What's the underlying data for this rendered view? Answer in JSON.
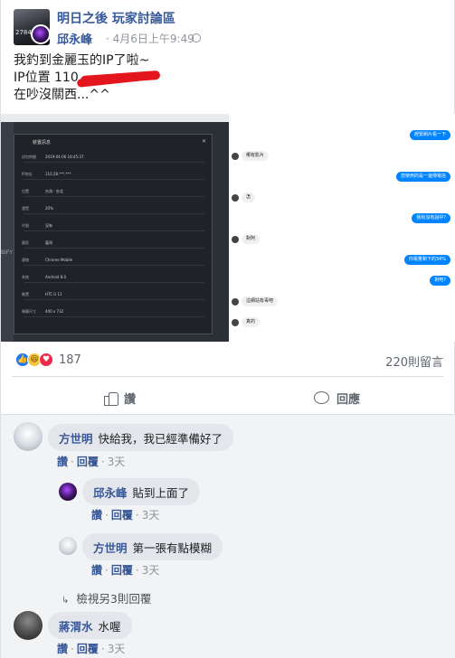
{
  "post": {
    "group_name": "明日之後 玩家討論區",
    "group_avatar_text": "2784",
    "poster_name": "邱永峰",
    "time": "· 4月6日上午9:49",
    "text_line1": "我釣到金麗玉的IP了啦~",
    "text_line2": "IP位置 110.",
    "text_line3": "在吵沒關西...^^",
    "reaction_count": "187",
    "comment_count": "220則留言",
    "like_label": "讚",
    "comment_label": "回應"
  },
  "screenshot_left": {
    "title": "裝置訊息",
    "side_label": "BIFY",
    "rows": [
      {
        "k": "封包時間",
        "v": "2019-04-06 18:45:37"
      },
      {
        "k": "IP地址",
        "v": "110.28.***.***"
      },
      {
        "k": "位置",
        "v": "台灣 · 台北"
      },
      {
        "k": "瀏覽",
        "v": "20%"
      },
      {
        "k": "代號",
        "v": "沒有"
      },
      {
        "k": "國家",
        "v": "臺灣"
      },
      {
        "k": "連線",
        "v": "Chrome Mobile"
      },
      {
        "k": "系統",
        "v": "Android 8.0"
      },
      {
        "k": "裝置",
        "v": "HTC U 11"
      },
      {
        "k": "螢幕尺寸",
        "v": "400 x 732"
      }
    ]
  },
  "screenshot_right": {
    "messages": [
      {
        "side": "right",
        "text": "趕緊刷片看一下"
      },
      {
        "side": "left",
        "text": "哪有影片"
      },
      {
        "side": "right",
        "text": "您使用的是一邊傳電信"
      },
      {
        "side": "left",
        "text": "怎"
      },
      {
        "side": "right",
        "text": "我有沒有說中?"
      },
      {
        "side": "left",
        "text": "對阿"
      },
      {
        "side": "right",
        "text": "你電量剩下的34%"
      },
      {
        "side": "right",
        "text": "對吧?"
      },
      {
        "side": "left",
        "text": "這網站有毒吧"
      },
      {
        "side": "left",
        "text": "真的"
      }
    ]
  },
  "comments": [
    {
      "name": "方世明",
      "text": "快給我，我已經準備好了",
      "like": "讚",
      "reply": "回覆",
      "time": "3天"
    },
    {
      "name": "邱永峰",
      "text": "貼到上面了",
      "like": "讚",
      "reply": "回覆",
      "time": "3天"
    },
    {
      "name": "方世明",
      "text": "第一張有點模糊",
      "like": "讚",
      "reply": "回覆",
      "time": "3天"
    },
    {
      "name": "蔣渭水",
      "text": "水喔",
      "like": "讚",
      "reply": "回覆",
      "time": "3天"
    }
  ],
  "more_replies": "檢視另3則回覆",
  "colors": {
    "link": "#385898",
    "messenger_blue": "#0084ff",
    "like_blue": "#2078f4",
    "love_red": "#f0284a",
    "haha_yellow": "#f7c43d",
    "redaction": "#e4161d"
  }
}
